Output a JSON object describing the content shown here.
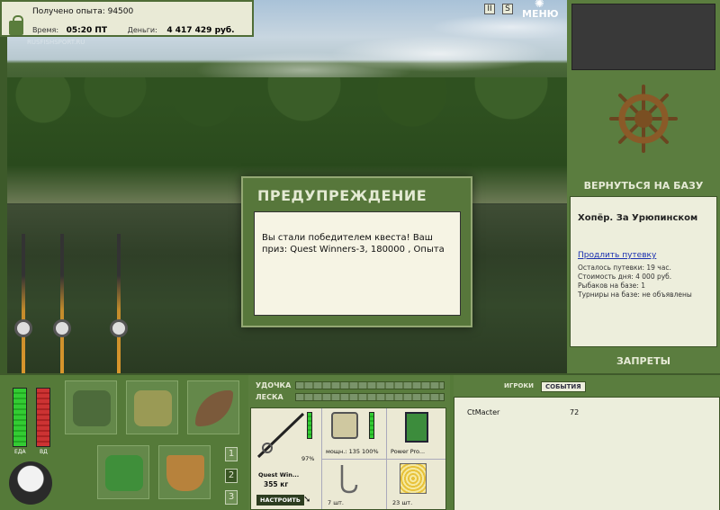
{
  "header": {
    "experience": "Получено опыта: 94500",
    "time_label": "Время:",
    "time_value": "05:20 ПТ",
    "money_label": "Деньги:",
    "money_value": "4 417 429 руб.",
    "watermark": "RUSFISHSPORT.RU",
    "menu_label": "МЕНЮ",
    "icon_pause": "II",
    "icon_s": "S"
  },
  "dialog": {
    "title": "ПРЕДУПРЕЖДЕНИЕ",
    "message": "Вы стали победителем квеста! Ваш приз: Quest Winners-3, 180000 , Опыта"
  },
  "right_panel": {
    "back_to_base": "ВЕРНУТЬСЯ НА БАЗУ",
    "location": "Хопёр. За Урюпинском",
    "extend_trip": "Продлить путевку",
    "remaining": "Осталось путевки: 19 час.",
    "day_cost": "Стоимость дня: 4 000 руб.",
    "fishers": "Рыбаков на базе: 1",
    "tournaments": "Турниры на базе: не объявлены",
    "bans": "ЗАПРЕТЫ"
  },
  "status_bars": {
    "food_label": "ЕДА",
    "water_label": "ВД"
  },
  "inventory": {
    "pages": [
      "1",
      "2",
      "3"
    ],
    "active_page": "2"
  },
  "tackle": {
    "rod_label": "УДОЧКА",
    "line_label": "ЛЕСКА",
    "rod_name": "Quest Win...",
    "rod_weight": "355 кг",
    "rod_percent": "97%",
    "setup_button": "НАСТРОИТЬ",
    "reel_power": "мощн.: 135",
    "reel_percent": "100%",
    "line_name": "Power Pro...",
    "hook_count": "7 шт.",
    "bait_count": "23 шт."
  },
  "events": {
    "tab_players": "ИГРОКИ",
    "tab_events": "СОБЫТИЯ",
    "rows": [
      {
        "name": "CtMacter",
        "value": "72"
      }
    ]
  }
}
